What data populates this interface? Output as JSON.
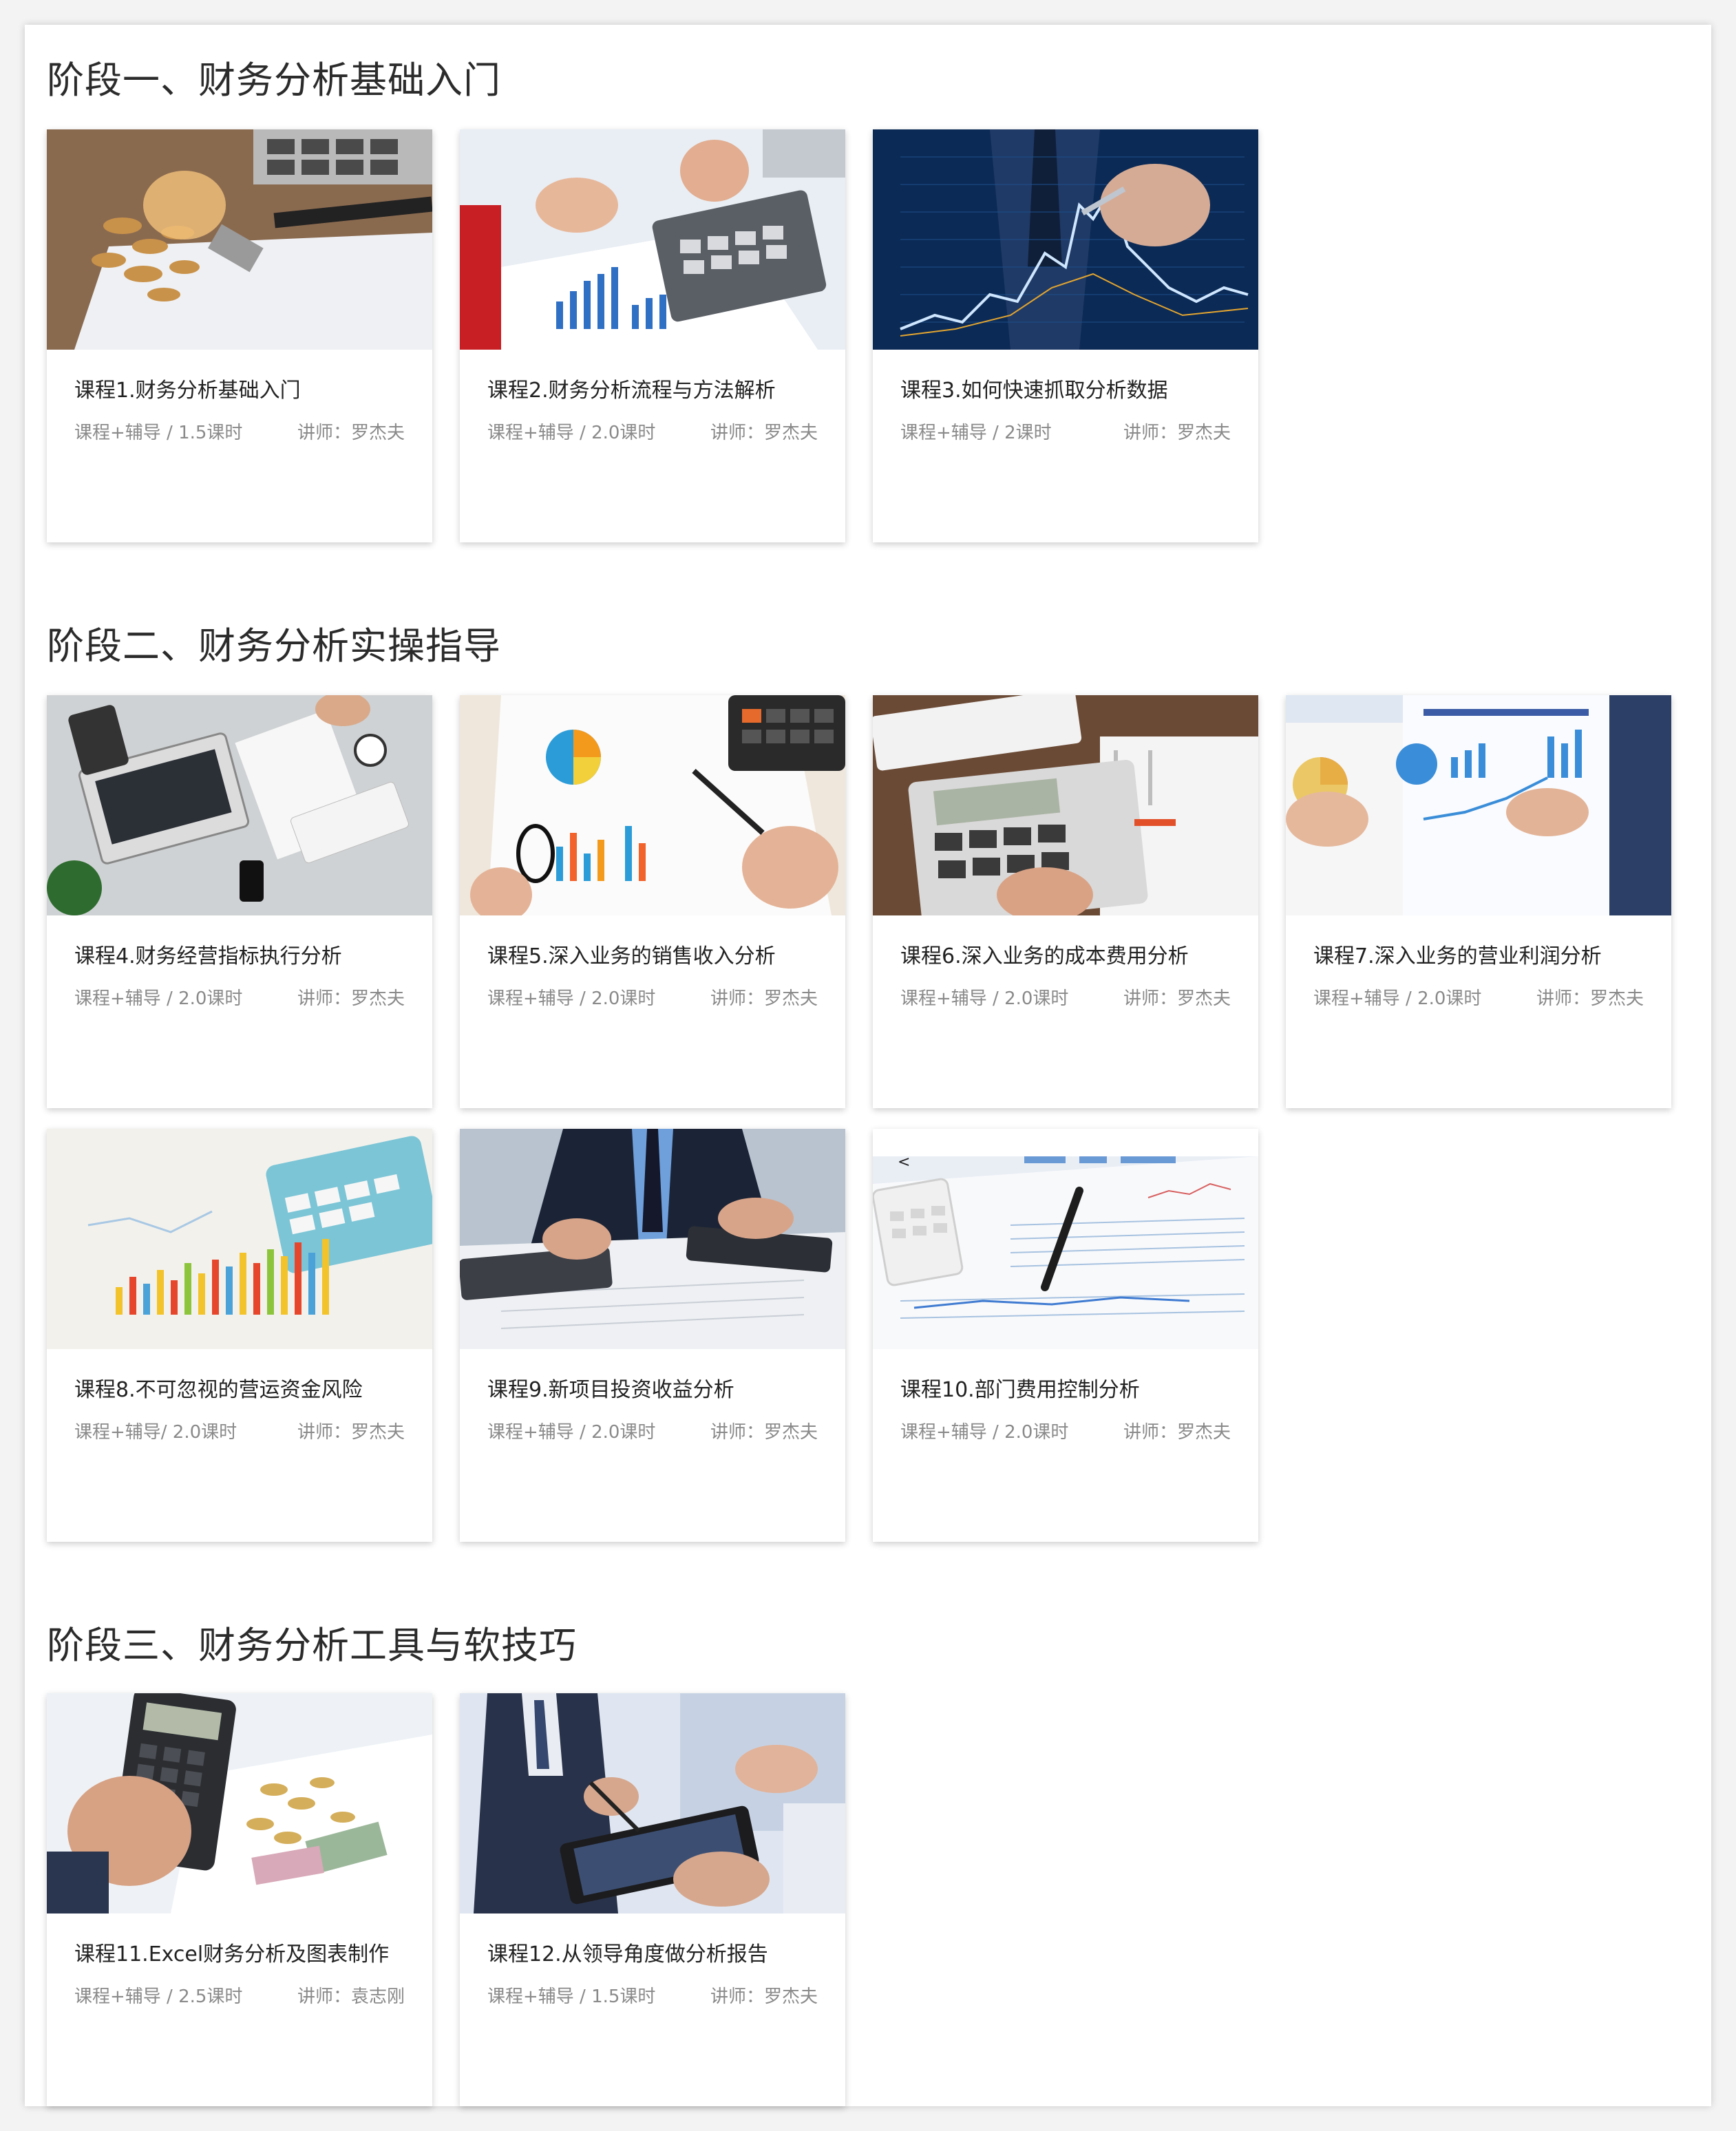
{
  "stages": [
    {
      "title": "阶段一、财务分析基础入门"
    },
    {
      "title": "阶段二、财务分析实操指导"
    },
    {
      "title": "阶段三、财务分析工具与软技巧"
    }
  ],
  "courses": [
    {
      "title": "课程1.财务分析基础入门",
      "meta": "课程+辅导 / 1.5课时",
      "teacher": "讲师：罗杰夫",
      "image": "coins-lightbulb-calculator"
    },
    {
      "title": "课程2.财务分析流程与方法解析",
      "meta": "课程+辅导 / 2.0课时",
      "teacher": "讲师：罗杰夫",
      "image": "hands-calculator-charts"
    },
    {
      "title": "课程3.如何快速抓取分析数据",
      "meta": "课程+辅导 / 2课时",
      "teacher": "讲师：罗杰夫",
      "image": "stock-chart-screen"
    },
    {
      "title": "课程4.财务经营指标执行分析",
      "meta": "课程+辅导 / 2.0课时",
      "teacher": "讲师：罗杰夫",
      "image": "desk-laptop-documents"
    },
    {
      "title": "课程5.深入业务的销售收入分析",
      "meta": "课程+辅导 / 2.0课时",
      "teacher": "讲师：罗杰夫",
      "image": "pie-chart-report"
    },
    {
      "title": "课程6.深入业务的成本费用分析",
      "meta": "课程+辅导 / 2.0课时",
      "teacher": "讲师：罗杰夫",
      "image": "calculator-binder"
    },
    {
      "title": "课程7.深入业务的营业利润分析",
      "meta": "课程+辅导 / 2.0课时",
      "teacher": "讲师：罗杰夫",
      "image": "business-report-analysis"
    },
    {
      "title": "课程8.不可忽视的营运资金风险",
      "meta": "课程+辅导/ 2.0课时",
      "teacher": "讲师：罗杰夫",
      "image": "bar-chart-calculator"
    },
    {
      "title": "课程9.新项目投资收益分析",
      "meta": "课程+辅导 / 2.0课时",
      "teacher": "讲师：罗杰夫",
      "image": "businessman-calculator"
    },
    {
      "title": "课程10.部门费用控制分析",
      "meta": "课程+辅导 / 2.0课时",
      "teacher": "讲师：罗杰夫",
      "image": "pen-calculator-spreadsheet"
    },
    {
      "title": "课程11.Excel财务分析及图表制作",
      "meta": "课程+辅导 / 2.5课时",
      "teacher": "讲师：袁志刚",
      "image": "calculator-coins-hand"
    },
    {
      "title": "课程12.从领导角度做分析报告",
      "meta": "课程+辅导 / 1.5课时",
      "teacher": "讲师：罗杰夫",
      "image": "business-tablet-meeting"
    }
  ],
  "stray_text": "<",
  "colors": {
    "background": "#f3f3f3",
    "panel": "#ffffff",
    "title": "#2b2b2b",
    "meta": "#8a8a8a"
  }
}
